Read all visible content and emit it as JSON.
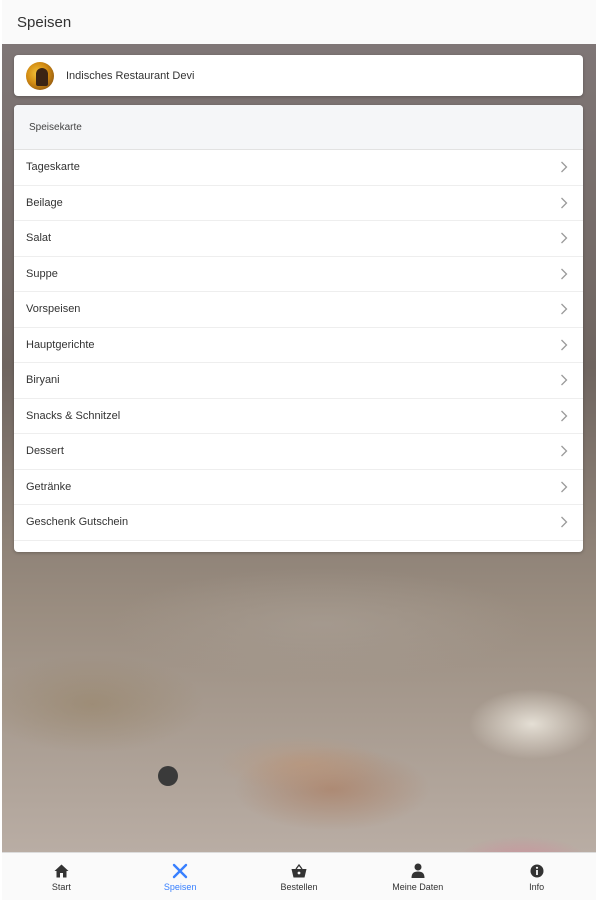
{
  "header": {
    "title": "Speisen"
  },
  "restaurant": {
    "name": "Indisches Restaurant Devi"
  },
  "menu": {
    "heading": "Speisekarte",
    "items": [
      {
        "label": "Tageskarte"
      },
      {
        "label": "Beilage"
      },
      {
        "label": "Salat"
      },
      {
        "label": "Suppe"
      },
      {
        "label": "Vorspeisen"
      },
      {
        "label": "Hauptgerichte"
      },
      {
        "label": "Biryani"
      },
      {
        "label": "Snacks & Schnitzel"
      },
      {
        "label": "Dessert"
      },
      {
        "label": "Getränke"
      },
      {
        "label": "Geschenk Gutschein"
      }
    ]
  },
  "tabs": [
    {
      "label": "Start",
      "icon": "home-icon",
      "active": false
    },
    {
      "label": "Speisen",
      "icon": "cutlery-icon",
      "active": true
    },
    {
      "label": "Bestellen",
      "icon": "basket-icon",
      "active": false
    },
    {
      "label": "Meine Daten",
      "icon": "person-icon",
      "active": false
    },
    {
      "label": "Info",
      "icon": "info-icon",
      "active": false
    }
  ],
  "colors": {
    "accent": "#3880ff",
    "text": "#333333"
  }
}
